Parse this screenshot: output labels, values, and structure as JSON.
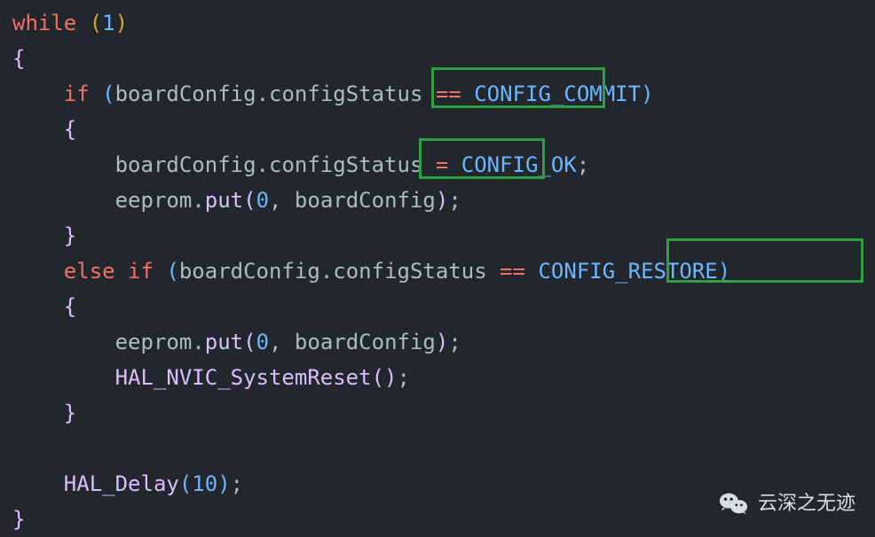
{
  "code": {
    "while": "while",
    "one": "1",
    "if": "if",
    "else": "else",
    "obj": "boardConfig",
    "prop": "configStatus",
    "eq": "==",
    "assign": "=",
    "c_commit": "CONFIG_COMMIT",
    "c_ok": "CONFIG_OK",
    "c_restore": "CONFIG_RESTORE",
    "eeprom": "eeprom",
    "put": "put",
    "zero": "0",
    "reset": "HAL_NVIC_SystemReset",
    "delay": "HAL_Delay",
    "ten": "10",
    "dot": ".",
    "comma": ",",
    "semi": ";",
    "lparen": "(",
    "rparen": ")",
    "lbrace": "{",
    "rbrace": "}",
    "space": " "
  },
  "watermark": {
    "text": "云深之无迹"
  },
  "highlights": [
    {
      "id": "highlight-config-commit",
      "target": "CONFIG_COMMIT"
    },
    {
      "id": "highlight-config-ok",
      "target": "CONFIG_OK"
    },
    {
      "id": "highlight-config-restore",
      "target": "CONFIG_RESTORE"
    }
  ]
}
